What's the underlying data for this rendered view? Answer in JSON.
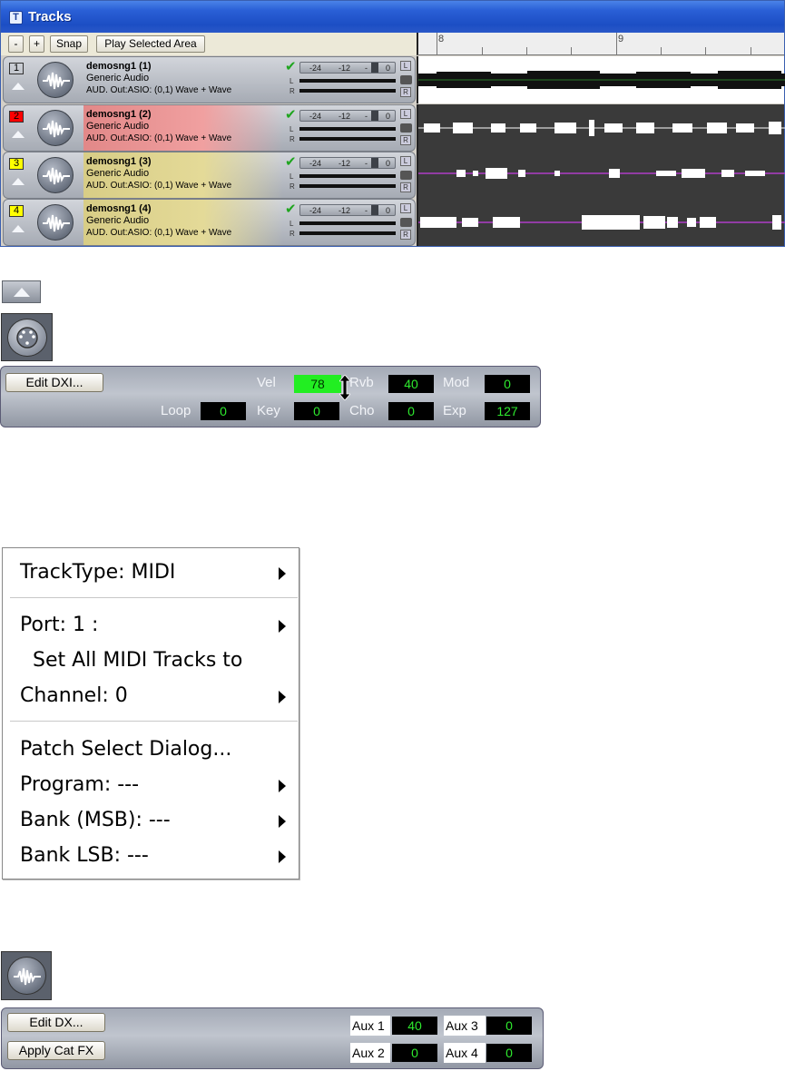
{
  "window": {
    "title": "Tracks",
    "icon_letter": "T"
  },
  "toolbar": {
    "minus": "-",
    "plus": "+",
    "snap": "Snap",
    "play_area": "Play Selected Area"
  },
  "ruler": {
    "marks": [
      "8",
      "9"
    ]
  },
  "tracks": [
    {
      "number": "1",
      "name": "demosng1 (1)",
      "type": "Generic Audio",
      "output": "AUD. Out:ASIO: (0,1) Wave + Wave",
      "num_color": "#d4d0c8",
      "tint": "#c4c8cf"
    },
    {
      "number": "2",
      "name": "demosng1 (2)",
      "type": "Generic Audio",
      "output": "AUD. Out:ASIO: (0,1) Wave + Wave",
      "num_color": "#ff0000",
      "tint": "#e28888"
    },
    {
      "number": "3",
      "name": "demosng1 (3)",
      "type": "Generic Audio",
      "output": "AUD. Out:ASIO: (0,1) Wave + Wave",
      "num_color": "#ffff00",
      "tint": "#d8cd86"
    },
    {
      "number": "4",
      "name": "demosng1 (4)",
      "type": "Generic Audio",
      "output": "AUD. Out:ASIO: (0,1) Wave + Wave",
      "num_color": "#ffff00",
      "tint": "#d8cd86"
    }
  ],
  "volume": {
    "marks": [
      "-24",
      "-12",
      "-",
      "0"
    ],
    "left": "L",
    "right": "R",
    "pan_left": "L",
    "pan_right": "R"
  },
  "dxi_panel": {
    "edit_button": "Edit DXI...",
    "vel_label": "Vel",
    "vel": "78",
    "rvb_label": "Rvb",
    "rvb": "40",
    "mod_label": "Mod",
    "mod": "0",
    "loop_label": "Loop",
    "loop": "0",
    "key_label": "Key",
    "key": "0",
    "cho_label": "Cho",
    "cho": "0",
    "exp_label": "Exp",
    "exp": "127"
  },
  "context_menu": {
    "track_type": "TrackType: MIDI",
    "port": "Port: 1 :",
    "set_all": "Set All MIDI Tracks to",
    "channel": "Channel: 0",
    "patch_dialog": "Patch Select Dialog...",
    "program": "Program: ---",
    "bank_msb": "Bank (MSB): ---",
    "bank_lsb": "Bank LSB: ---"
  },
  "dx_panel": {
    "edit_button": "Edit DX...",
    "apply_button": "Apply Cat FX",
    "aux1_label": "Aux 1",
    "aux1": "40",
    "aux2_label": "Aux 2",
    "aux2": "0",
    "aux3_label": "Aux 3",
    "aux3": "0",
    "aux4_label": "Aux 4",
    "aux4": "0"
  }
}
